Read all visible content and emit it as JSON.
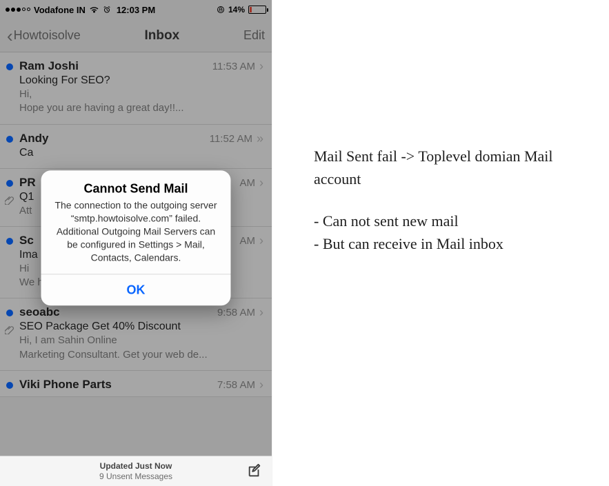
{
  "status": {
    "carrier": "Vodafone IN",
    "time": "12:03 PM",
    "battery_text": "14%",
    "alarm_icon": "alarm-icon"
  },
  "nav": {
    "back_label": "Howtoisolve",
    "title": "Inbox",
    "edit_label": "Edit"
  },
  "messages": [
    {
      "from": "Ram Joshi",
      "time": "11:53 AM",
      "subject": "Looking For SEO?",
      "preview": "Hi,\nHope you are having a great day!!...",
      "unread": true,
      "attachment": false
    },
    {
      "from": "Andy",
      "time": "11:52 AM",
      "subject": "Ca",
      "preview": "",
      "unread": true,
      "attachment": false
    },
    {
      "from": "PR",
      "time": "AM",
      "subject": "Q1",
      "preview": "Att",
      "unread": true,
      "attachment": true
    },
    {
      "from": "Sc",
      "time": "AM",
      "subject": "Ima",
      "preview": "Hi\nWe have in-house team of expert image...",
      "unread": true,
      "attachment": false
    },
    {
      "from": "seoabc",
      "time": "9:58 AM",
      "subject": "SEO Package Get 40% Discount",
      "preview": "Hi, I am Sahin Online\nMarketing Consultant. Get your web de...",
      "unread": true,
      "attachment": true
    },
    {
      "from": "Viki  Phone Parts",
      "time": "7:58 AM",
      "subject": "",
      "preview": "",
      "unread": true,
      "attachment": false
    }
  ],
  "footer": {
    "line1": "Updated Just Now",
    "line2": "9 Unsent Messages"
  },
  "alert": {
    "title": "Cannot Send Mail",
    "body": "The connection to the outgoing server “smtp.howtoisolve.com” failed. Additional Outgoing Mail Servers can be configured in Settings > Mail, Contacts, Calendars.",
    "ok": "OK"
  },
  "notes": {
    "line1": "Mail Sent fail -> Toplevel domian Mail account",
    "bullet1": "- Can not sent new mail",
    "bullet2": "- But can receive in Mail inbox"
  }
}
